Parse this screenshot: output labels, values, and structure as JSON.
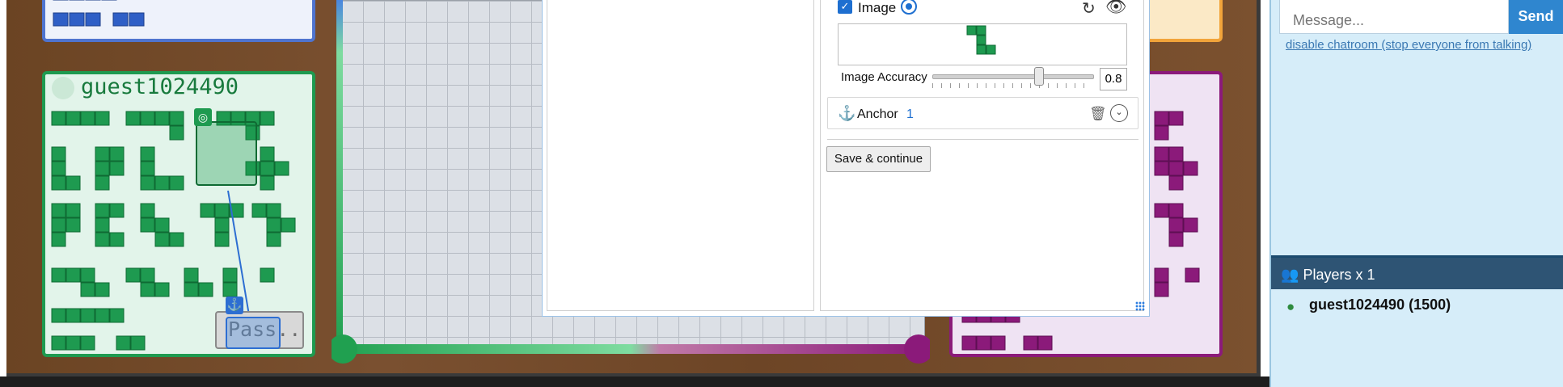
{
  "game": {
    "player_name": "guest1024490",
    "pass_label": "Pass",
    "pass_suffix": ".."
  },
  "dialog": {
    "image_label": "Image",
    "image_checked": true,
    "accuracy_label": "Image Accuracy",
    "accuracy_value": "0.8",
    "anchor_label": "Anchor",
    "anchor_value": "1",
    "save_label": "Save & continue"
  },
  "chat": {
    "message_placeholder": "Message...",
    "send_label": "Send",
    "disable_link": "disable chatroom (stop everyone from talking)"
  },
  "players": {
    "header": "Players x 1",
    "entry": "guest1024490 (1500)"
  },
  "colors": {
    "green_pieces": "#1e9a50",
    "purple_pieces": "#8b1a7a",
    "blue_pieces": "#2f5fc6",
    "accent": "#2f86cf",
    "header_bg": "#2e5474"
  },
  "icons": [
    "target-icon",
    "refresh-icon",
    "eye-icon",
    "anchor-icon",
    "trash-icon",
    "chevron-down-icon",
    "users-icon",
    "user-icon"
  ]
}
